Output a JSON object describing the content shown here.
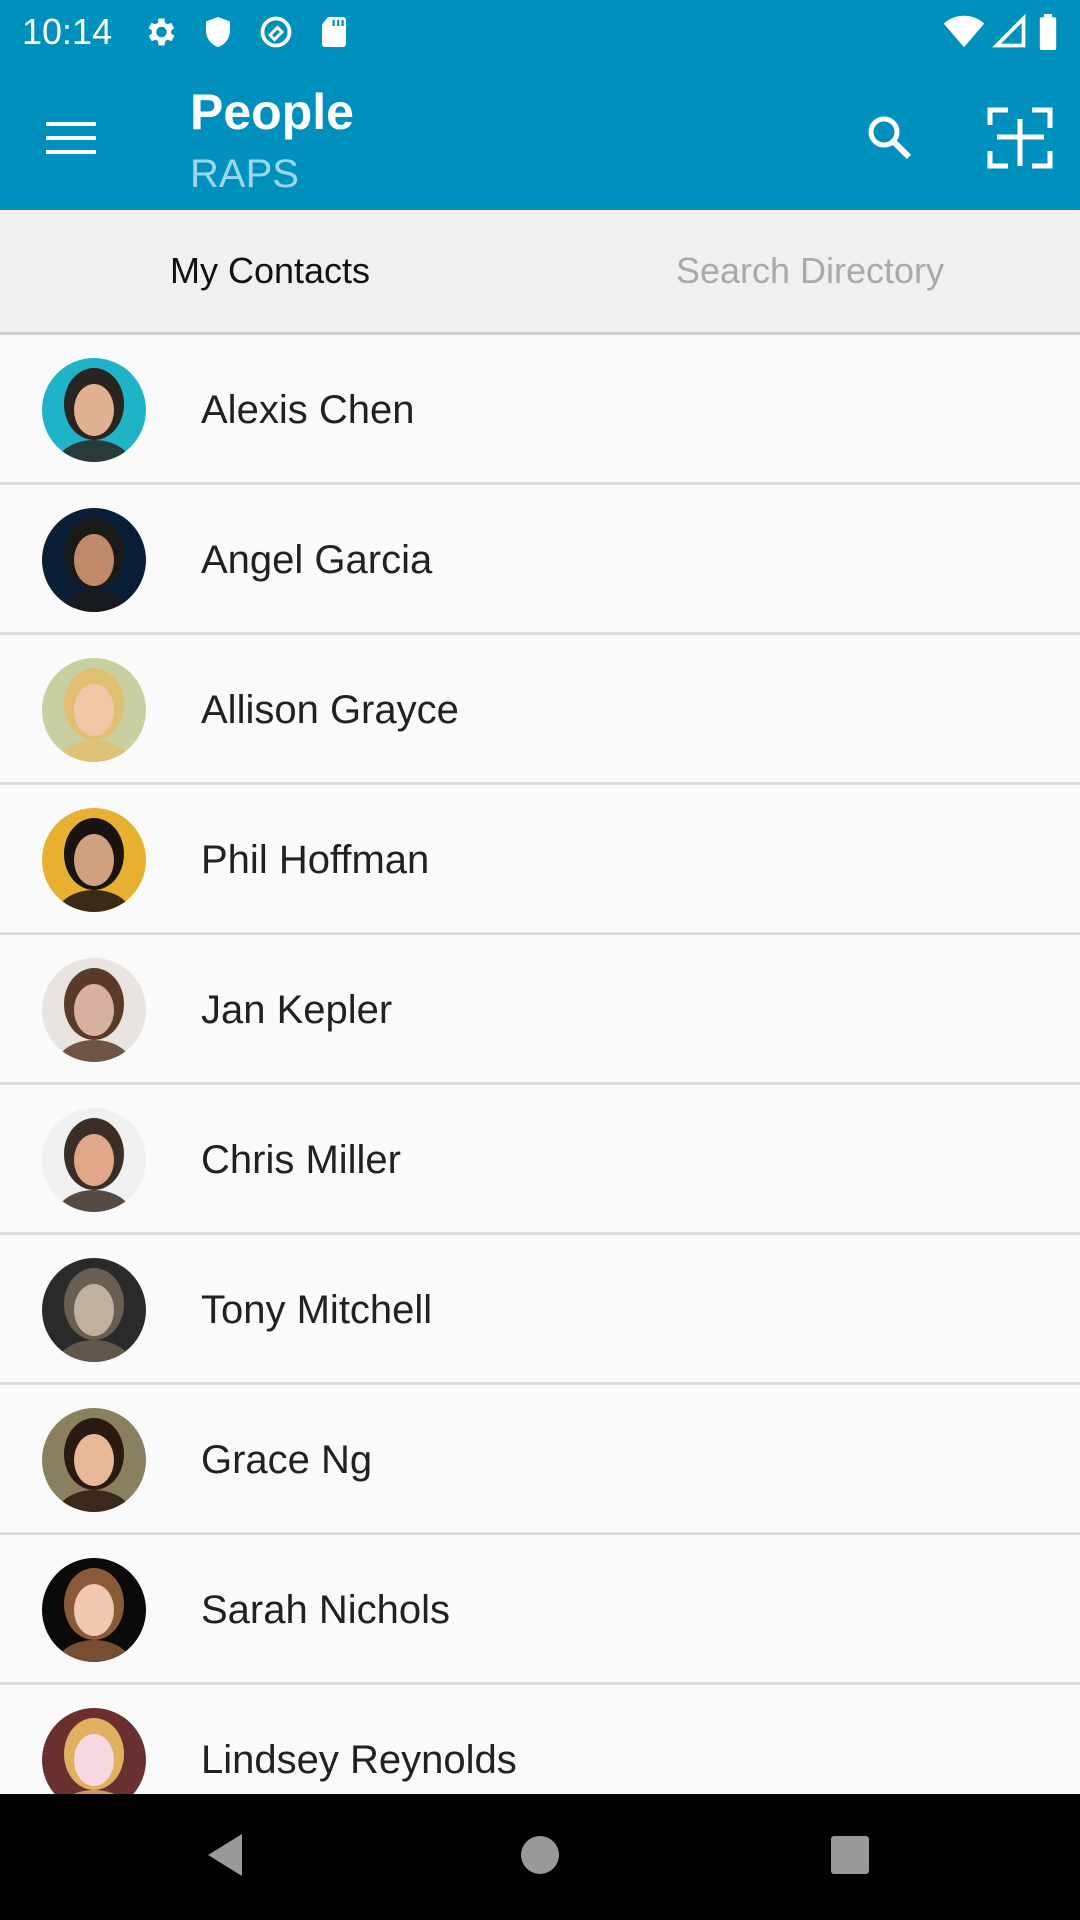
{
  "status_bar": {
    "time": "10:14",
    "left_icons": [
      "gear-icon",
      "shield-icon",
      "at-sync-icon",
      "sd-card-icon"
    ],
    "right_icons": [
      "wifi-icon",
      "cell-signal-icon",
      "battery-icon"
    ]
  },
  "app_bar": {
    "title": "People",
    "subtitle": "RAPS",
    "menu_icon": "hamburger-menu-icon",
    "actions": [
      "search-icon",
      "scan-qr-icon"
    ],
    "color": "#0090bd",
    "subtitle_color": "#9bd7ec"
  },
  "tabs": [
    {
      "label": "My Contacts",
      "active": true
    },
    {
      "label": "Search Directory",
      "active": false
    }
  ],
  "contacts": [
    {
      "name": "Alexis Chen",
      "avatar_colors": [
        "#1fb3c8",
        "#2a2420",
        "#e0b090"
      ]
    },
    {
      "name": "Angel Garcia",
      "avatar_colors": [
        "#0b1e38",
        "#1a1a1a",
        "#c08a6a"
      ]
    },
    {
      "name": "Allison Grayce",
      "avatar_colors": [
        "#c8cfa0",
        "#e0c070",
        "#f0c8a8"
      ]
    },
    {
      "name": "Phil Hoffman",
      "avatar_colors": [
        "#e8b030",
        "#1a1410",
        "#d0a080"
      ]
    },
    {
      "name": "Jan Kepler",
      "avatar_colors": [
        "#e8e4e0",
        "#5a3a28",
        "#d8b0a0"
      ]
    },
    {
      "name": "Chris Miller",
      "avatar_colors": [
        "#f0f0f0",
        "#3a2e26",
        "#e0a888"
      ]
    },
    {
      "name": "Tony Mitchell",
      "avatar_colors": [
        "#2a2a2a",
        "#6a5e50",
        "#c0b0a0"
      ]
    },
    {
      "name": "Grace Ng",
      "avatar_colors": [
        "#8a8060",
        "#2a1a12",
        "#e8b898"
      ]
    },
    {
      "name": "Sarah Nichols",
      "avatar_colors": [
        "#0a0a0a",
        "#8a5a38",
        "#f0c8b0"
      ]
    },
    {
      "name": "Lindsey Reynolds",
      "avatar_colors": [
        "#6a3030",
        "#e0b060",
        "#f8d8e0"
      ]
    }
  ],
  "nav_bar": {
    "buttons": [
      "back-icon",
      "home-icon",
      "recents-icon"
    ]
  }
}
